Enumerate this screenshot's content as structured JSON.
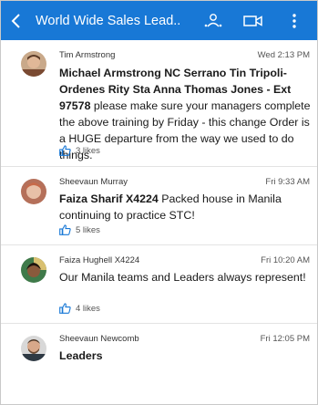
{
  "header": {
    "title": "World Wide Sales Lead...",
    "back_icon": "chevron-left-icon",
    "people_icon": "people-icon",
    "video_icon": "video-call-icon",
    "more_icon": "more-vertical-icon",
    "color": "#1878d6"
  },
  "posts": [
    {
      "author": "Tim Armstrong",
      "time": "Wed 2:13 PM",
      "mention": "Michael Armstrong NC Serrano Tin Tripoli-Ordenes Rity Sta Anna Thomas Jones - Ext 97578",
      "text": " please make sure your managers complete the above training by Friday - this change Order is a HUGE departure from the way we used to do things.",
      "likes": "3 likes"
    },
    {
      "author": "Sheevaun Murray",
      "time": "Fri 9:33 AM",
      "mention": "Faiza Sharif X4224",
      "text": " Packed house in Manila continuing to practice STC!",
      "likes": "5 likes"
    },
    {
      "author": "Faiza Hughell X4224",
      "time": "Fri 10:20 AM",
      "mention": "",
      "text": "Our Manila teams and Leaders always represent!",
      "likes": "4 likes"
    },
    {
      "author": "Sheevaun Newcomb",
      "time": "Fri 12:05 PM",
      "mention": "Leaders",
      "text": ""
    }
  ],
  "icons": {
    "like": "thumbs-up-icon"
  },
  "colors": {
    "accent": "#1878d6"
  }
}
